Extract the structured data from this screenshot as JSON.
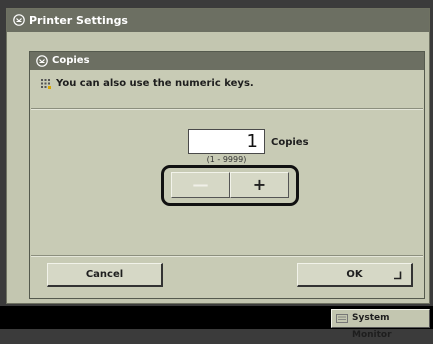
{
  "window": {
    "title": "Printer Settings",
    "title_icon": "printer-settings-icon"
  },
  "dialog": {
    "title": "Copies",
    "title_icon": "printer-settings-icon",
    "hint": "You can also use the numeric keys.",
    "hint_icon": "numeric-keypad-icon"
  },
  "copies": {
    "value": "1",
    "unit": "Copies",
    "range": "(1 - 9999)"
  },
  "stepper": {
    "minus_label": "—",
    "plus_label": "+",
    "minus_enabled": false
  },
  "buttons": {
    "cancel": "Cancel",
    "ok": "OK",
    "ok_icon": "enter-icon"
  },
  "status_bar": {
    "monitor_label": "System Monitor",
    "monitor_icon": "system-monitor-icon"
  },
  "colors": {
    "panel_bg": "#c3c6b0",
    "title_bar": "#6c6f62",
    "highlight_outline": "#111111",
    "status_bar_bg": "#000000"
  }
}
